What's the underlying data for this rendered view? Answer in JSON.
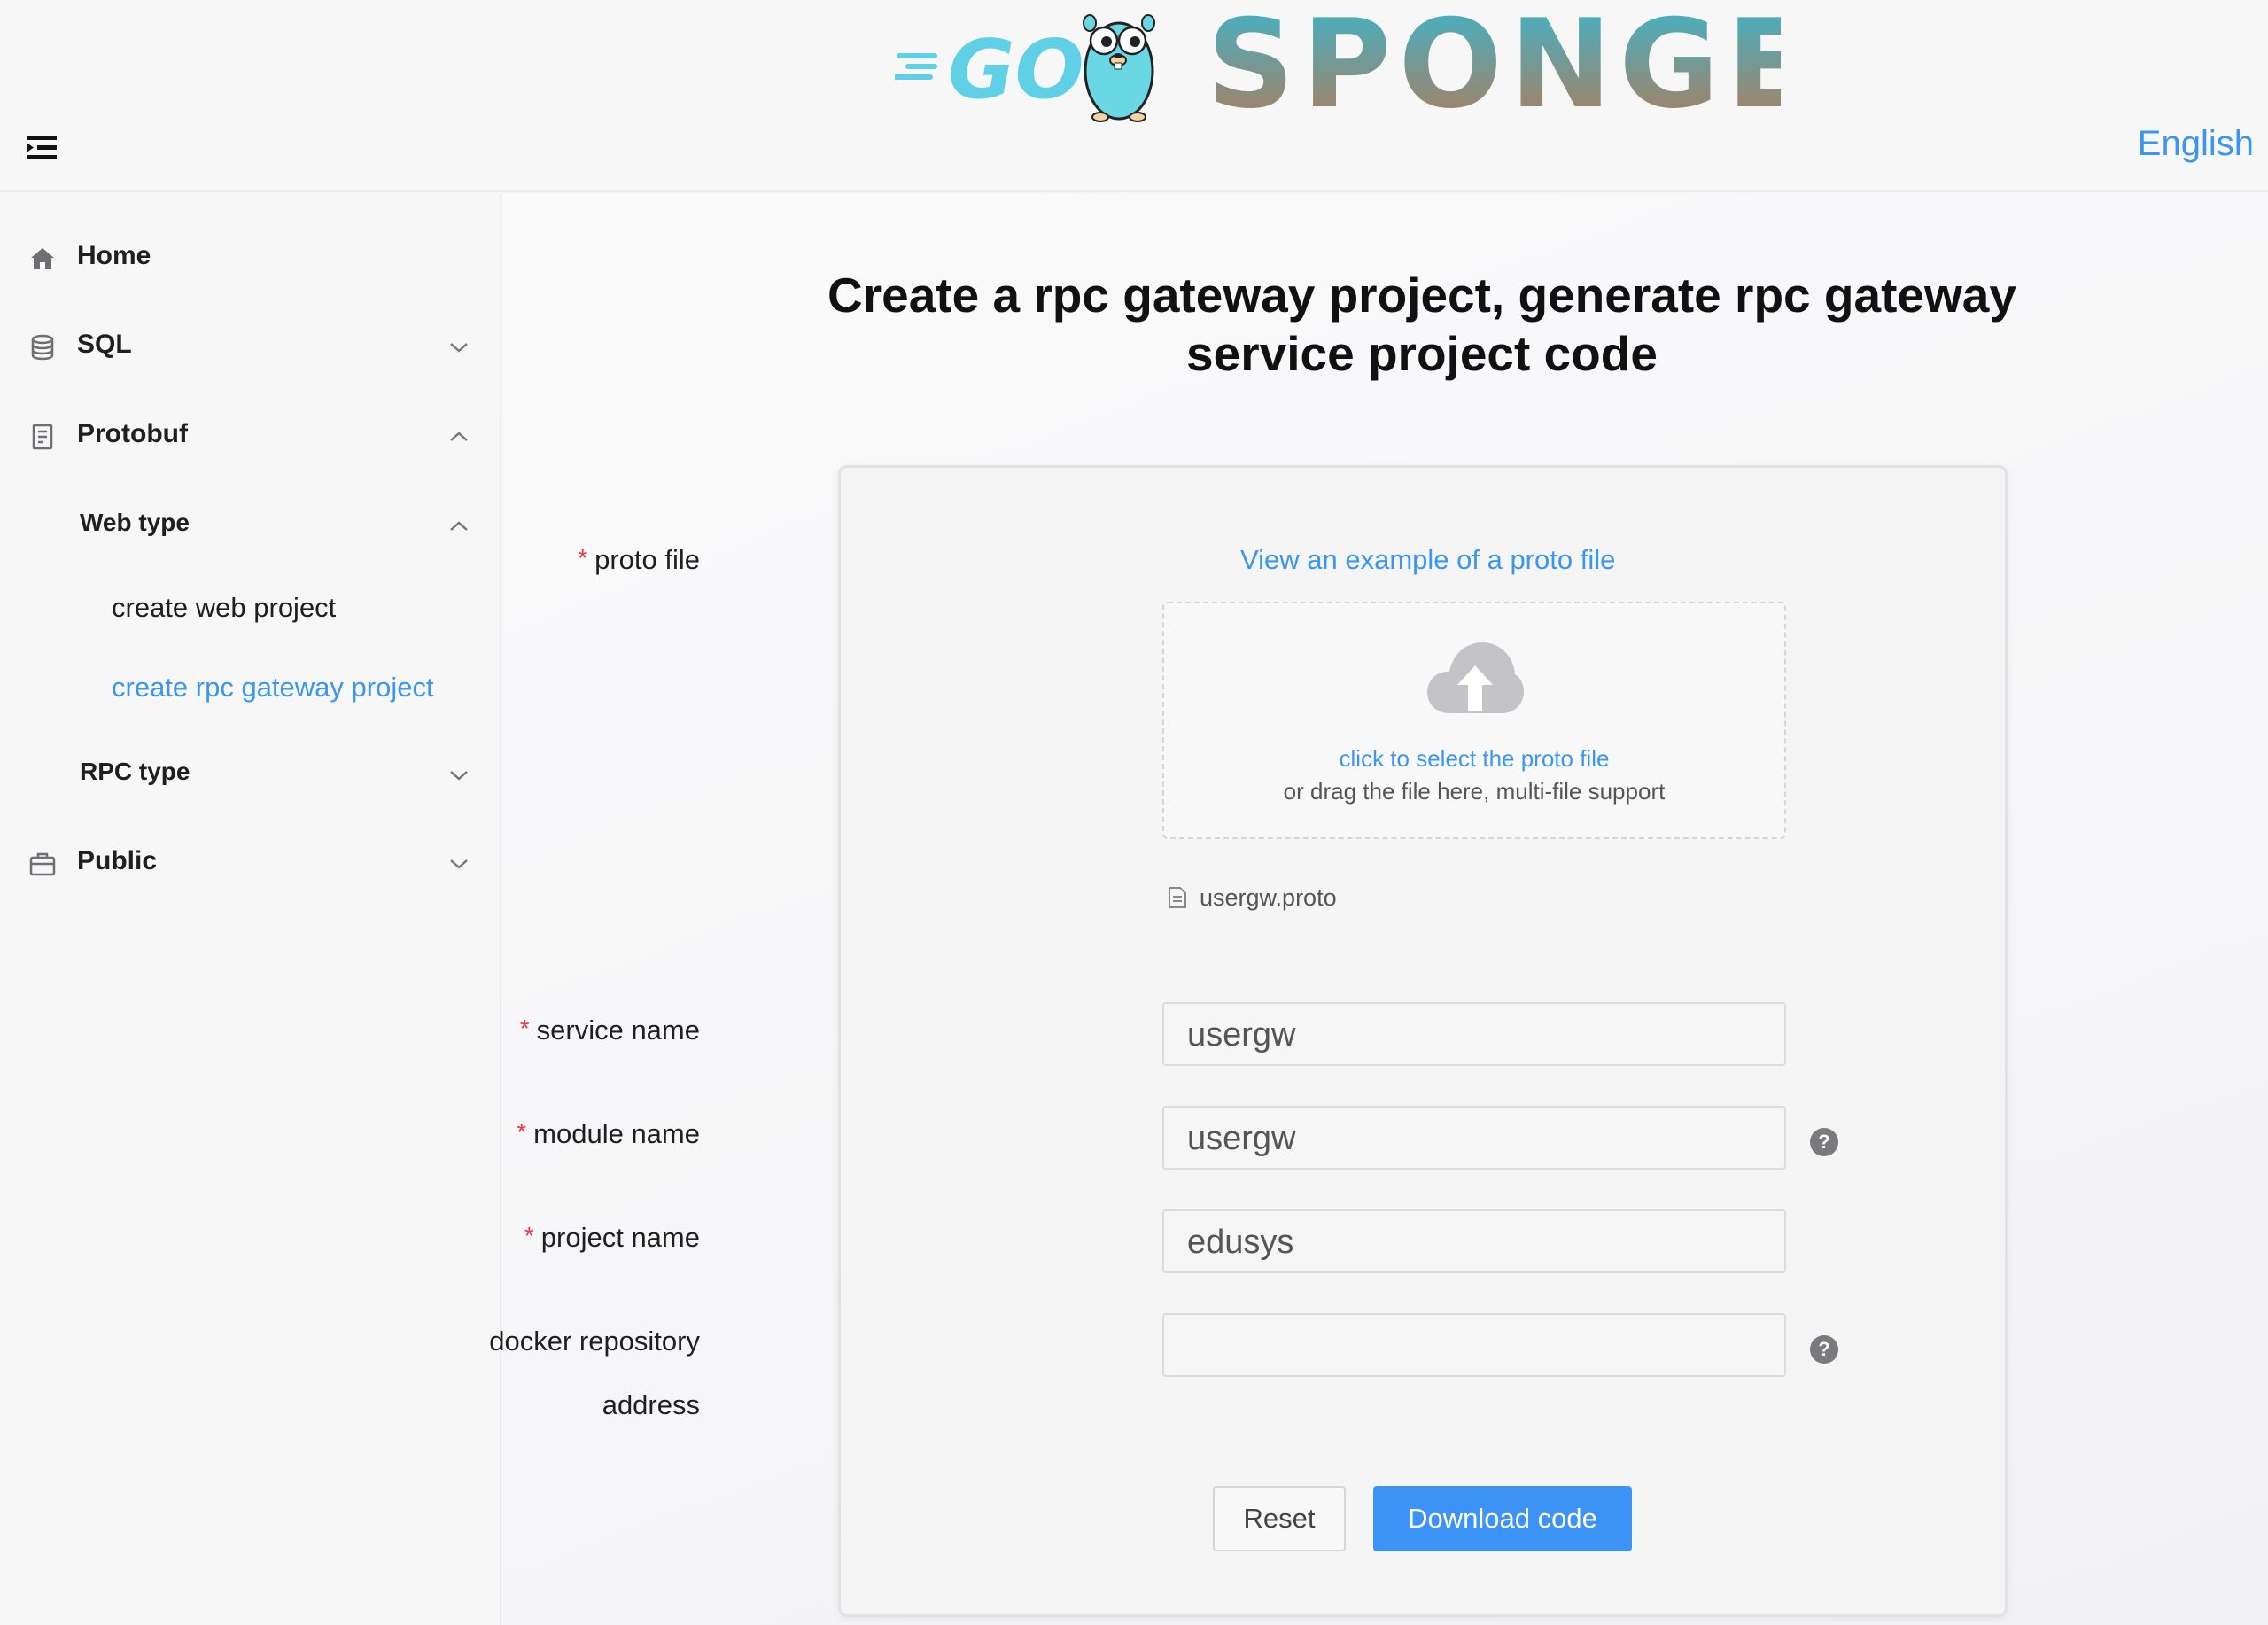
{
  "header": {
    "logo_text": "GO SPONGE",
    "language": "English",
    "menu_icon": "menu-fold-icon"
  },
  "sidebar": {
    "items": [
      {
        "label": "Home",
        "icon": "home-icon"
      },
      {
        "label": "SQL",
        "icon": "database-icon",
        "expanded": false
      },
      {
        "label": "Protobuf",
        "icon": "file-text-icon",
        "expanded": true
      },
      {
        "label": "Web type",
        "expanded": true
      },
      {
        "label": "create web project"
      },
      {
        "label": "create rpc gateway project",
        "active": true
      },
      {
        "label": "RPC type",
        "expanded": false
      },
      {
        "label": "Public",
        "icon": "briefcase-icon",
        "expanded": false
      }
    ]
  },
  "main": {
    "title": "Create a rpc gateway project, generate rpc gateway service project code",
    "form": {
      "proto_file_label": "proto file",
      "proto_example_link": "View an example of a proto file",
      "upload_click_text": "click to select the proto file",
      "upload_drag_text": "or drag the file here, multi-file support",
      "uploaded_file": "usergw.proto",
      "service_name_label": "service name",
      "service_name_value": "usergw",
      "module_name_label": "module name",
      "module_name_value": "usergw",
      "project_name_label": "project name",
      "project_name_value": "edusys",
      "docker_repo_label_line1": "docker repository",
      "docker_repo_label_line2": "address",
      "docker_repo_value": "",
      "required_mark": "*",
      "help_mark": "?"
    },
    "buttons": {
      "reset": "Reset",
      "download": "Download code"
    }
  },
  "colors": {
    "accent": "#3b96f0",
    "primary_button": "#3d93f5",
    "required": "#f5333f"
  }
}
